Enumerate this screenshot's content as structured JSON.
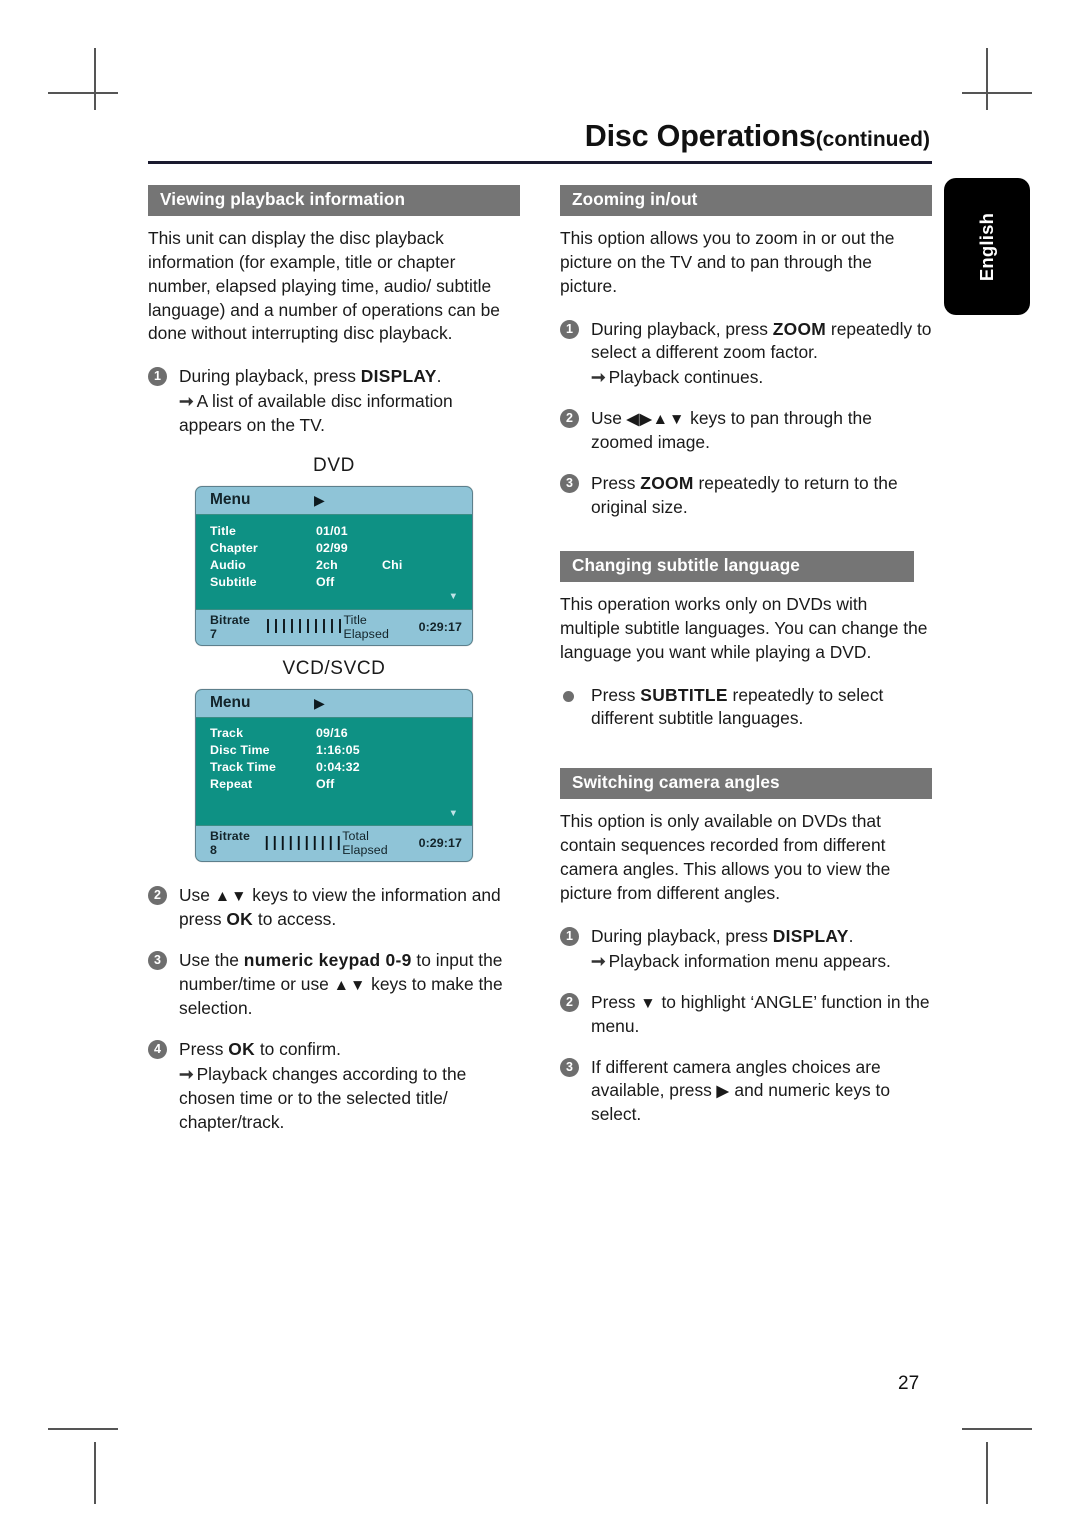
{
  "document": {
    "title_main": "Disc Operations",
    "title_suffix": "(continued)",
    "page_number": "27",
    "language_tab": "English"
  },
  "left_column": {
    "section1": {
      "heading": "Viewing playback information",
      "intro": "This unit can display the disc playback information (for example, title or chapter number, elapsed playing time, audio/ subtitle language) and a number of operations can be done without interrupting disc playback.",
      "steps": [
        {
          "num": "1",
          "text_before": "During playback, press ",
          "bold": "DISPLAY",
          "text_after": ".",
          "result": "A list of available disc information appears on the TV."
        },
        {
          "num": "2",
          "text_before": "Use ",
          "keys": "▲▼",
          "text_mid": " keys to view the information and press ",
          "bold": "OK",
          "text_after": " to access."
        },
        {
          "num": "3",
          "text_before": "Use the ",
          "bold": "numeric keypad 0-9",
          "text_mid": " to input the number/time or use ",
          "keys": "▲▼",
          "text_after": " keys to make the selection."
        },
        {
          "num": "4",
          "text_before": "Press ",
          "bold": "OK",
          "text_after": " to confirm.",
          "result": "Playback changes according to the chosen time or to the selected title/ chapter/track."
        }
      ]
    },
    "osd_dvd": {
      "label": "DVD",
      "menu_title": "Menu",
      "menu_arrow": "▶",
      "rows": [
        {
          "label": "Title",
          "value1": "01/01",
          "value2": ""
        },
        {
          "label": "Chapter",
          "value1": "02/99",
          "value2": ""
        },
        {
          "label": "Audio",
          "value1": "2ch",
          "value2": "Chi"
        },
        {
          "label": "Subtitle",
          "value1": "Off",
          "value2": ""
        }
      ],
      "scroll_caret": "▼",
      "footer": {
        "bitrate_label": "Bitrate 7",
        "bitrate_bars": "||||||||||",
        "elapsed_label": "Title Elapsed",
        "elapsed_time": "0:29:17"
      }
    },
    "osd_vcd": {
      "label": "VCD/SVCD",
      "menu_title": "Menu",
      "menu_arrow": "▶",
      "rows": [
        {
          "label": "Track",
          "value1": "09/16",
          "value2": ""
        },
        {
          "label": "Disc Time",
          "value1": "1:16:05",
          "value2": ""
        },
        {
          "label": "Track Time",
          "value1": "0:04:32",
          "value2": ""
        },
        {
          "label": "Repeat",
          "value1": "Off",
          "value2": ""
        }
      ],
      "scroll_caret": "▼",
      "footer": {
        "bitrate_label": "Bitrate 8",
        "bitrate_bars": "||||||||||",
        "elapsed_label": "Total Elapsed",
        "elapsed_time": "0:29:17"
      }
    }
  },
  "right_column": {
    "section_zoom": {
      "heading": "Zooming in/out",
      "intro": "This option allows you to zoom in or out the picture on the TV and to pan through the picture.",
      "steps": [
        {
          "num": "1",
          "text_before": "During playback, press ",
          "bold": "ZOOM",
          "text_after": " repeatedly to select a different zoom factor.",
          "result": "Playback continues."
        },
        {
          "num": "2",
          "text_before": "Use ",
          "keys": "◀▶▲▼",
          "text_after": " keys to pan through the zoomed image."
        },
        {
          "num": "3",
          "text_before": "Press ",
          "bold": "ZOOM",
          "text_after": " repeatedly to return to the original size."
        }
      ]
    },
    "section_subtitle": {
      "heading": "Changing subtitle language",
      "intro": "This operation works only on DVDs with multiple subtitle languages. You can change the language you want while playing a DVD.",
      "bullet": {
        "text_before": "Press ",
        "bold": "SUBTITLE",
        "text_after": " repeatedly to select different subtitle languages."
      }
    },
    "section_angles": {
      "heading": "Switching camera angles",
      "intro": "This option is only available on DVDs that contain sequences recorded from different camera angles. This allows you to view the picture from different angles.",
      "steps": [
        {
          "num": "1",
          "text_before": "During playback, press ",
          "bold": "DISPLAY",
          "text_after": ".",
          "result": "Playback information menu appears."
        },
        {
          "num": "2",
          "text_before": "Press ",
          "keys": "▼",
          "text_after": " to highlight ‘ANGLE’ function in the menu."
        },
        {
          "num": "3",
          "text_before": "If different camera angles choices are available, press ",
          "keys": "▶",
          "text_after": " and numeric keys to select."
        }
      ]
    }
  },
  "colors": {
    "section_header_bg": "#757575",
    "osd_header_bg": "#8fc4d7",
    "osd_body_bg": "#0e9184",
    "bullet_gray": "#6e6e6e",
    "tab_black": "#000000"
  }
}
